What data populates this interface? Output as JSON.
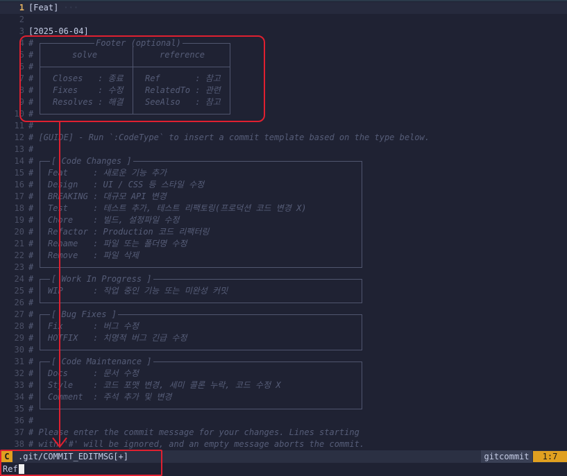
{
  "editor": {
    "lines": [
      {
        "n": "1",
        "text": "[Feat]",
        "plain": true,
        "current": true,
        "trail": " ···"
      },
      {
        "n": "2",
        "text": ""
      },
      {
        "n": "3",
        "text": "[2025-06-04]",
        "plain": true
      },
      {
        "n": "4",
        "text": "#"
      },
      {
        "n": "5",
        "text": "#"
      },
      {
        "n": "6",
        "text": "#"
      },
      {
        "n": "7",
        "text": "#"
      },
      {
        "n": "8",
        "text": "#"
      },
      {
        "n": "9",
        "text": "#"
      },
      {
        "n": "10",
        "text": "#"
      },
      {
        "n": "11",
        "text": "#"
      },
      {
        "n": "12",
        "text": "# [GUIDE] - Run `:CodeType` to insert a commit template based on the type below."
      },
      {
        "n": "13",
        "text": "#"
      },
      {
        "n": "14",
        "text": "#"
      },
      {
        "n": "15",
        "text": "#"
      },
      {
        "n": "16",
        "text": "#"
      },
      {
        "n": "17",
        "text": "#"
      },
      {
        "n": "18",
        "text": "#"
      },
      {
        "n": "19",
        "text": "#"
      },
      {
        "n": "20",
        "text": "#"
      },
      {
        "n": "21",
        "text": "#"
      },
      {
        "n": "22",
        "text": "#"
      },
      {
        "n": "23",
        "text": "#"
      },
      {
        "n": "24",
        "text": "#"
      },
      {
        "n": "25",
        "text": "#"
      },
      {
        "n": "26",
        "text": "#"
      },
      {
        "n": "27",
        "text": "#"
      },
      {
        "n": "28",
        "text": "#"
      },
      {
        "n": "29",
        "text": "#"
      },
      {
        "n": "30",
        "text": "#"
      },
      {
        "n": "31",
        "text": "#"
      },
      {
        "n": "32",
        "text": "#"
      },
      {
        "n": "33",
        "text": "#"
      },
      {
        "n": "34",
        "text": "#"
      },
      {
        "n": "35",
        "text": "#"
      },
      {
        "n": "36",
        "text": "#"
      },
      {
        "n": "37",
        "text": "# Please enter the commit message for your changes. Lines starting"
      },
      {
        "n": "38",
        "text": "# with '#' will be ignored, and an empty message aborts the commit."
      }
    ],
    "footer_box": {
      "title": "Footer (optional)",
      "col_solve": "solve",
      "col_reference": "reference",
      "solve_rows": [
        "Closes   : 종료",
        "Fixes    : 수정",
        "Resolves : 해결"
      ],
      "reference_rows": [
        "Ref       : 참고",
        "RelatedTo : 관련",
        "SeeAlso   : 참고"
      ]
    },
    "code_changes": {
      "title": "[ Code Changes ]",
      "rows": [
        "Feat     : 새로운 기능 추가",
        "Design   : UI / CSS 등 스타일 수정",
        "BREAKING : 대규모 API 변경",
        "Test     : 테스트 추가, 테스트 리팩토링(프로덕션 코드 변경 X)",
        "Chore    : 빌드, 설정파일 수정",
        "Refactor : Production 코드 리팩터링",
        "Rename   : 파일 또는 폴더명 수정",
        "Remove   : 파일 삭제"
      ]
    },
    "wip": {
      "title": "[ Work In Progress ]",
      "rows": [
        "WIP      : 작업 중인 기능 또는 미완성 커밋"
      ]
    },
    "bug_fixes": {
      "title": "[ Bug Fixes ]",
      "rows": [
        "Fix      : 버그 수정",
        "HOTFIX   : 치명적 버그 긴급 수정"
      ]
    },
    "code_maintenance": {
      "title": "[ Code Maintenance ]",
      "rows": [
        "Docs     : 문서 수정",
        "Style    : 코드 포맷 변경, 세미 콜론 누락, 코드 수정 X",
        "Comment  : 주석 추가 및 변경"
      ]
    }
  },
  "statusbar": {
    "mode": "C",
    "filename": ".git/COMMIT_EDITMSG[+]",
    "filetype": "gitcommit",
    "position": "1:7"
  },
  "cmdline": {
    "text": "Ref"
  },
  "colors": {
    "background": "#1f2233",
    "comment": "#565d78",
    "mode_accent": "#e0a020",
    "annotation_red": "#e02030"
  }
}
